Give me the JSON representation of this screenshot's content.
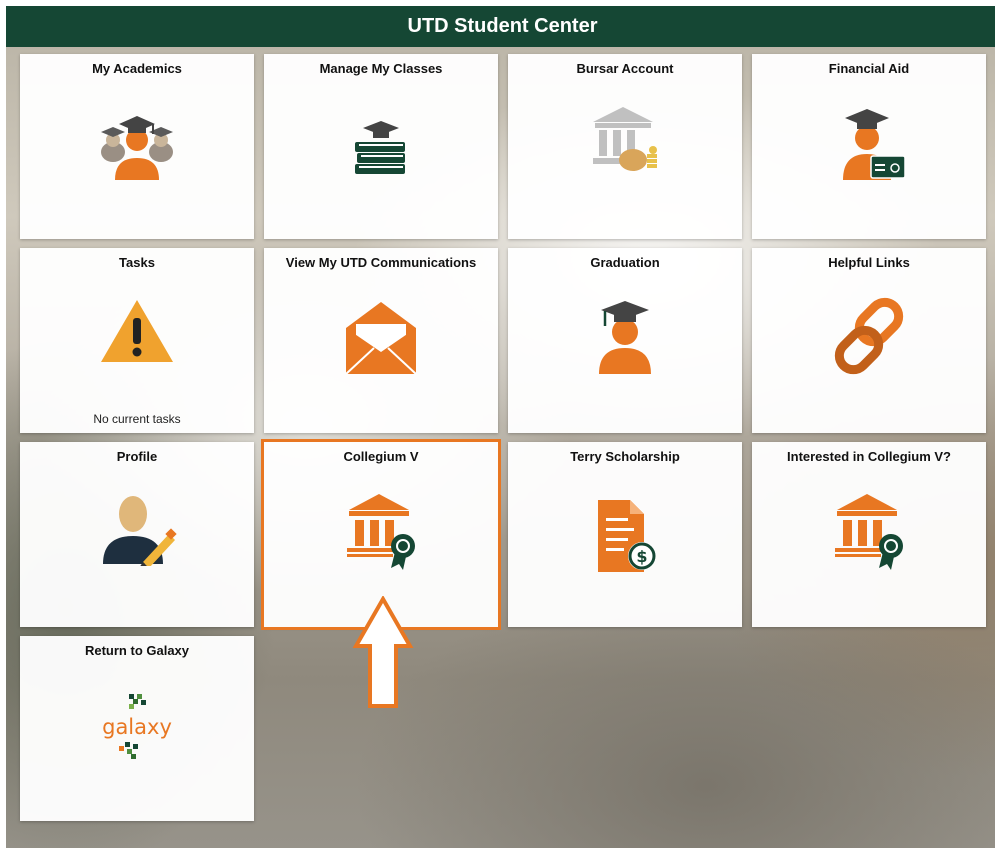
{
  "header": {
    "title": "UTD Student Center"
  },
  "tiles": [
    {
      "label": "My Academics",
      "icon": "graduates-group-icon"
    },
    {
      "label": "Manage My Classes",
      "icon": "books-cap-icon"
    },
    {
      "label": "Bursar Account",
      "icon": "bank-money-icon"
    },
    {
      "label": "Financial Aid",
      "icon": "graduate-card-icon"
    },
    {
      "label": "Tasks",
      "icon": "warning-icon",
      "status": "No current tasks"
    },
    {
      "label": "View My UTD Communications",
      "icon": "envelope-icon"
    },
    {
      "label": "Graduation",
      "icon": "graduate-icon"
    },
    {
      "label": "Helpful Links",
      "icon": "chain-link-icon"
    },
    {
      "label": "Profile",
      "icon": "profile-edit-icon"
    },
    {
      "label": "Collegium V",
      "icon": "institution-badge-icon",
      "highlighted": true
    },
    {
      "label": "Terry Scholarship",
      "icon": "document-dollar-icon"
    },
    {
      "label": "Interested in Collegium V?",
      "icon": "institution-badge-icon"
    },
    {
      "label": "Return to Galaxy",
      "icon": "galaxy-logo-icon",
      "logo_text": "galaxy"
    }
  ],
  "colors": {
    "header": "#154734",
    "accent": "#e87722",
    "green": "#154734"
  }
}
